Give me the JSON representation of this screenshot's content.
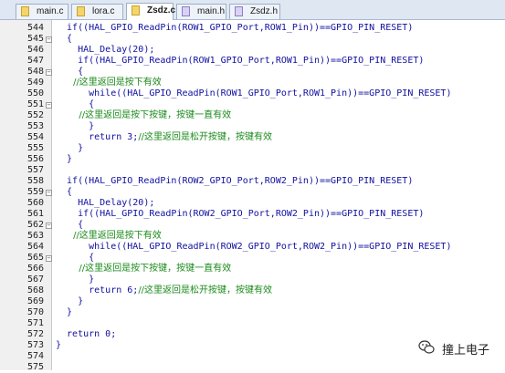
{
  "tabs": [
    {
      "label": "main.c",
      "kind": "c",
      "active": false
    },
    {
      "label": "lora.c",
      "kind": "c",
      "active": false
    },
    {
      "label": "Zsdz.c",
      "kind": "c",
      "active": true
    },
    {
      "label": "main.h",
      "kind": "h",
      "active": false
    },
    {
      "label": "Zsdz.h",
      "kind": "h",
      "active": false
    }
  ],
  "lines": [
    {
      "num": "544",
      "fold": "",
      "text": "  if((HAL_GPIO_ReadPin(ROW1_GPIO_Port,ROW1_Pin))==GPIO_PIN_RESET)"
    },
    {
      "num": "545",
      "fold": "minus",
      "text": "  {"
    },
    {
      "num": "546",
      "fold": "",
      "text": "    HAL_Delay(20);"
    },
    {
      "num": "547",
      "fold": "",
      "text": "    if((HAL_GPIO_ReadPin(ROW1_GPIO_Port,ROW1_Pin))==GPIO_PIN_RESET)"
    },
    {
      "num": "548",
      "fold": "minus",
      "text": "    {"
    },
    {
      "num": "549",
      "fold": "",
      "text": "      //这里返回是按下有效",
      "comment": true
    },
    {
      "num": "550",
      "fold": "",
      "text": "      while((HAL_GPIO_ReadPin(ROW1_GPIO_Port,ROW1_Pin))==GPIO_PIN_RESET)"
    },
    {
      "num": "551",
      "fold": "minus",
      "text": "      {"
    },
    {
      "num": "552",
      "fold": "",
      "text": "        //这里返回是按下按键，按键一直有效",
      "comment": true
    },
    {
      "num": "553",
      "fold": "",
      "text": "      }"
    },
    {
      "num": "554",
      "fold": "",
      "text": "      return 3;",
      "trail": "//这里返回是松开按键，按键有效"
    },
    {
      "num": "555",
      "fold": "",
      "text": "    }"
    },
    {
      "num": "556",
      "fold": "",
      "text": "  }"
    },
    {
      "num": "557",
      "fold": "",
      "text": ""
    },
    {
      "num": "558",
      "fold": "",
      "text": "  if((HAL_GPIO_ReadPin(ROW2_GPIO_Port,ROW2_Pin))==GPIO_PIN_RESET)"
    },
    {
      "num": "559",
      "fold": "minus",
      "text": "  {"
    },
    {
      "num": "560",
      "fold": "",
      "text": "    HAL_Delay(20);"
    },
    {
      "num": "561",
      "fold": "",
      "text": "    if((HAL_GPIO_ReadPin(ROW2_GPIO_Port,ROW2_Pin))==GPIO_PIN_RESET)"
    },
    {
      "num": "562",
      "fold": "minus",
      "text": "    {"
    },
    {
      "num": "563",
      "fold": "",
      "text": "      //这里返回是按下有效",
      "comment": true
    },
    {
      "num": "564",
      "fold": "",
      "text": "      while((HAL_GPIO_ReadPin(ROW2_GPIO_Port,ROW2_Pin))==GPIO_PIN_RESET)"
    },
    {
      "num": "565",
      "fold": "minus",
      "text": "      {"
    },
    {
      "num": "566",
      "fold": "",
      "text": "        //这里返回是按下按键，按键一直有效",
      "comment": true
    },
    {
      "num": "567",
      "fold": "",
      "text": "      }"
    },
    {
      "num": "568",
      "fold": "",
      "text": "      return 6;",
      "trail": "//这里返回是松开按键，按键有效"
    },
    {
      "num": "569",
      "fold": "",
      "text": "    }"
    },
    {
      "num": "570",
      "fold": "",
      "text": "  }"
    },
    {
      "num": "571",
      "fold": "",
      "text": ""
    },
    {
      "num": "572",
      "fold": "",
      "text": "  return 0;"
    },
    {
      "num": "573",
      "fold": "",
      "text": "}"
    },
    {
      "num": "574",
      "fold": "",
      "text": ""
    },
    {
      "num": "575",
      "fold": "",
      "text": ""
    }
  ],
  "watermark": {
    "text": "撞上电子",
    "icon": "wechat-icon"
  },
  "colors": {
    "keyword_text": "#1010a0",
    "comment": "#1a8a1a",
    "gutter_bg": "#f0f0f0",
    "tabbar_bg": "#dfe7f2"
  }
}
